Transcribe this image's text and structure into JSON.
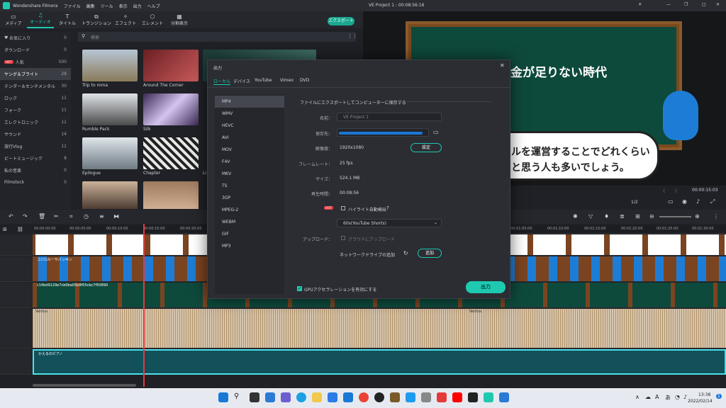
{
  "app": {
    "title": "Wondershare Filmora",
    "project": "VE Project 1 : 00:08:56:16",
    "menu": [
      "ファイル",
      "編集",
      "ツール",
      "表示",
      "出力",
      "ヘルプ"
    ]
  },
  "toolbar": {
    "tabs": [
      "メディア",
      "オーディオ",
      "タイトル",
      "トランジション",
      "エフェクト",
      "エレメント",
      "分割表示"
    ],
    "export": "エクスポート"
  },
  "sidebar": {
    "items": [
      {
        "label": "お気に入り",
        "count": "0"
      },
      {
        "label": "ダウンロード",
        "count": "0"
      },
      {
        "label": "人気",
        "count": "500",
        "hot": "HOT"
      },
      {
        "label": "ヤング＆ブライト",
        "count": "28"
      },
      {
        "label": "テンダー＆センチメンタル",
        "count": "30"
      },
      {
        "label": "ロック",
        "count": "11"
      },
      {
        "label": "フォーク",
        "count": "11"
      },
      {
        "label": "エレクトロニック",
        "count": "11"
      },
      {
        "label": "サウンド",
        "count": "14"
      },
      {
        "label": "旅行Vlog",
        "count": "11"
      },
      {
        "label": "ビートミュージック",
        "count": "8"
      },
      {
        "label": "私の音楽",
        "count": "0"
      },
      {
        "label": "Filmstock",
        "count": "0"
      }
    ]
  },
  "search": {
    "placeholder": "検索"
  },
  "media": {
    "items": [
      "Trip to roma",
      "Around The Corner",
      "Rumble Pack",
      "Silk",
      "Epilogue",
      "Chapter",
      "Li"
    ]
  },
  "preview": {
    "caption_top": "金が足りない時代",
    "caption_1": "ルを運営することでどれくらい",
    "caption_2": "と思う人も多いでしょう。",
    "timecode": "00:00:15:03",
    "ratio": "1/2"
  },
  "ruler": [
    "00:00:00:00",
    "00:00:05:00",
    "00:00:10:00",
    "00:00:15:00",
    "00:00:20:00",
    "00:01:05:00",
    "00:01:10:00",
    "00:01:15:00",
    "00:01:20:00",
    "00:01:25:00",
    "00:01:30:00"
  ],
  "tracks": {
    "t4": "コジロルーサバンキン",
    "t3": "c14bd9129e7cb0ba05b8f05cbc7f50890",
    "t2a": "Ventus",
    "t2b": "Ventus",
    "t1": "かえるのピアノ"
  },
  "dialog": {
    "title": "出力",
    "tabs": [
      "ローカル",
      "デバイス",
      "YouTube",
      "Vimeo",
      "DVD"
    ],
    "formats": [
      "MP4",
      "WMV",
      "HEVC",
      "AVI",
      "MOV",
      "F4V",
      "MKV",
      "TS",
      "3GP",
      "MPEG-2",
      "WEBM",
      "GIF",
      "MP3"
    ],
    "heading": "ファイルにエクスポートしてコンピューターに保存する",
    "name_label": "名前：",
    "name_value": "VE Project 1",
    "save_label": "保存先：",
    "res_label": "解像度：",
    "res_value": "1920x1080",
    "settings_btn": "設定",
    "fps_label": "フレームレート：",
    "fps_value": "25 fps",
    "size_label": "サイズ：",
    "size_value": "524.1 MB",
    "dur_label": "再生時間：",
    "dur_value": "00:08:56",
    "hot": "HOT",
    "highlight_label": "ハイライト自動検出",
    "highlight_select": "60s(YouTube Shorts)",
    "upload_label": "アップロード：",
    "upload_opt": "クラウドにアップロード",
    "drive_label": "ネットワークドライブの追加",
    "add_btn": "追加",
    "gpu_label": "GPUアクセラレーションを有効にする",
    "export_btn": "出力"
  },
  "taskbar": {
    "time": "13:38",
    "date": "2022/02/14",
    "lang": "A",
    "ime": "あ",
    "notif": "1"
  }
}
